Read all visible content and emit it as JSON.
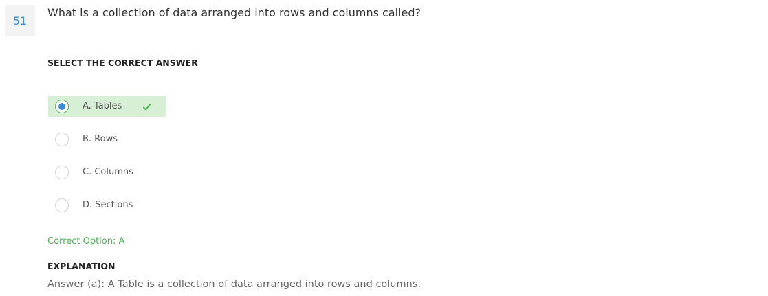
{
  "question": {
    "number": "51",
    "text": "What is a collection of data arranged into rows and columns called?"
  },
  "answer_section": {
    "heading": "SELECT THE CORRECT ANSWER"
  },
  "options": [
    {
      "label": "A. Tables",
      "selected": true,
      "correct": true
    },
    {
      "label": "B. Rows",
      "selected": false,
      "correct": false
    },
    {
      "label": "C. Columns",
      "selected": false,
      "correct": false
    },
    {
      "label": "D. Sections",
      "selected": false,
      "correct": false
    }
  ],
  "result": {
    "correct_option_text": "Correct Option: A"
  },
  "explanation": {
    "heading": "EXPLANATION",
    "text": "Answer (a): A Table is a collection of data arranged into rows and columns."
  },
  "colors": {
    "accent_blue": "#3d8fd6",
    "correct_green": "#4caf50",
    "correct_bg": "#d7efd4"
  },
  "icons": {
    "selected": "radio-selected-icon",
    "check": "checkmark-icon"
  }
}
